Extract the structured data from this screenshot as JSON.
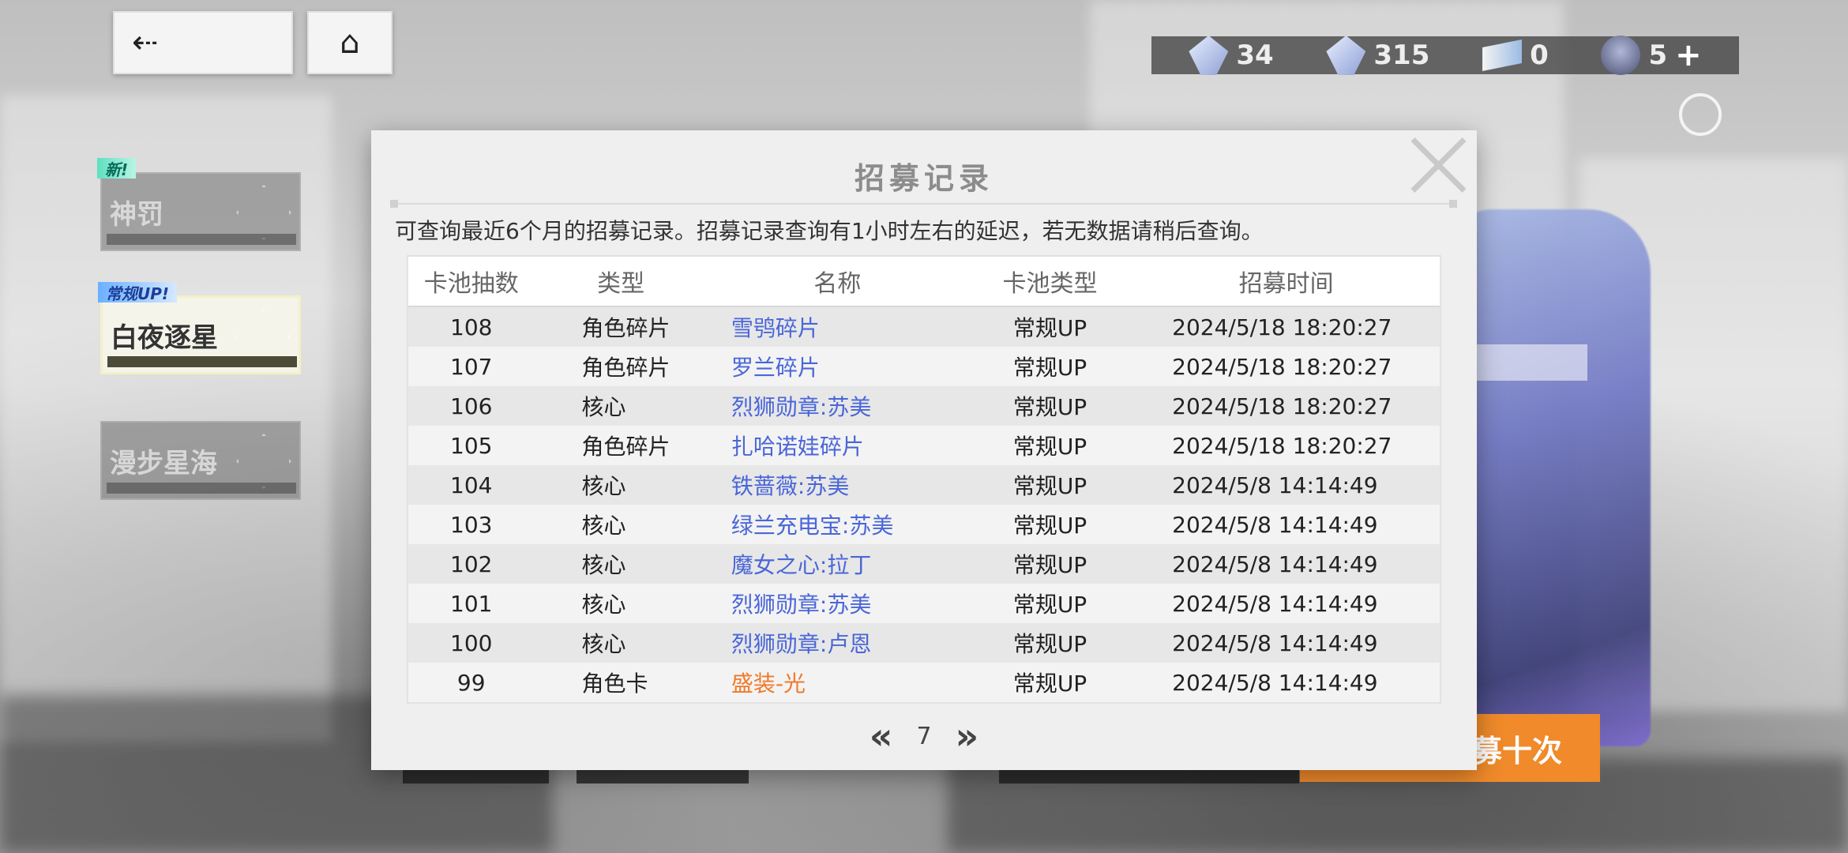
{
  "topbar": {
    "back_icon": "back-arrow-icon",
    "home_icon": "home-icon",
    "currencies": [
      {
        "icon": "crystal-icon",
        "value": "34"
      },
      {
        "icon": "star-crystal-icon",
        "value": "315"
      },
      {
        "icon": "ticket-icon",
        "value": "0"
      },
      {
        "icon": "avatar-icon",
        "value": "5"
      }
    ],
    "plus_label": "+"
  },
  "banners": [
    {
      "tag": "新!",
      "label": "神罚",
      "active": false
    },
    {
      "tag": "常规UP!",
      "label": "白夜逐星",
      "active": true
    },
    {
      "tag": "",
      "label": "漫步星海",
      "active": false
    }
  ],
  "right_panel": {
    "ten_draw_label": "招募十次"
  },
  "modal": {
    "title": "招募记录",
    "notice": "可查询最近6个月的招募记录。招募记录查询有1小时左右的延迟，若无数据请稍后查询。",
    "columns": [
      "卡池抽数",
      "类型",
      "名称",
      "卡池类型",
      "招募时间"
    ],
    "rows": [
      {
        "count": "108",
        "type": "角色碎片",
        "name": "雪鸮碎片",
        "pool": "常规UP",
        "time": "2024/5/18 18:20:27",
        "rarity": "blue"
      },
      {
        "count": "107",
        "type": "角色碎片",
        "name": "罗兰碎片",
        "pool": "常规UP",
        "time": "2024/5/18 18:20:27",
        "rarity": "blue"
      },
      {
        "count": "106",
        "type": "核心",
        "name": "烈狮勋章:苏美",
        "pool": "常规UP",
        "time": "2024/5/18 18:20:27",
        "rarity": "blue"
      },
      {
        "count": "105",
        "type": "角色碎片",
        "name": "扎哈诺娃碎片",
        "pool": "常规UP",
        "time": "2024/5/18 18:20:27",
        "rarity": "blue"
      },
      {
        "count": "104",
        "type": "核心",
        "name": "铁蔷薇:苏美",
        "pool": "常规UP",
        "time": "2024/5/8 14:14:49",
        "rarity": "blue"
      },
      {
        "count": "103",
        "type": "核心",
        "name": "绿兰充电宝:苏美",
        "pool": "常规UP",
        "time": "2024/5/8 14:14:49",
        "rarity": "blue"
      },
      {
        "count": "102",
        "type": "核心",
        "name": "魔女之心:拉丁",
        "pool": "常规UP",
        "time": "2024/5/8 14:14:49",
        "rarity": "blue"
      },
      {
        "count": "101",
        "type": "核心",
        "name": "烈狮勋章:苏美",
        "pool": "常规UP",
        "time": "2024/5/8 14:14:49",
        "rarity": "blue"
      },
      {
        "count": "100",
        "type": "核心",
        "name": "烈狮勋章:卢恩",
        "pool": "常规UP",
        "time": "2024/5/8 14:14:49",
        "rarity": "blue"
      },
      {
        "count": "99",
        "type": "角色卡",
        "name": "盛装-光",
        "pool": "常规UP",
        "time": "2024/5/8 14:14:49",
        "rarity": "orange"
      }
    ],
    "pager": {
      "prev": "«",
      "page": "7",
      "next": "»"
    }
  },
  "colors": {
    "name_blue": "#4a66d8",
    "name_orange": "#f07a2a",
    "accent_orange": "#f08a2a"
  }
}
